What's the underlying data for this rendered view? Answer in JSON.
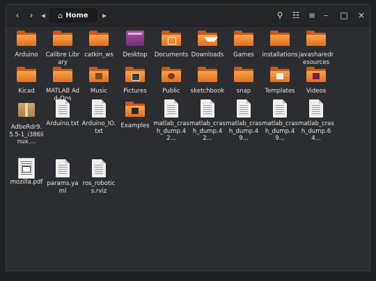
{
  "window": {
    "location": "Home"
  },
  "toolbar": {
    "back_glyph": "‹",
    "forward_glyph": "›",
    "crumb_left_glyph": "◂",
    "crumb_right_glyph": "▸",
    "home_icon": "⌂",
    "search_icon": "⚲",
    "view_icon": "☷",
    "menu_icon": "≡",
    "minimize_glyph": "–",
    "maximize_glyph": "□",
    "close_glyph": "×"
  },
  "items": [
    {
      "label": "Arduino",
      "kind": "folder"
    },
    {
      "label": "Calibre Library",
      "kind": "folder"
    },
    {
      "label": "catkin_ws",
      "kind": "folder"
    },
    {
      "label": "Desktop",
      "kind": "desktop"
    },
    {
      "label": "Documents",
      "kind": "folder-grid"
    },
    {
      "label": "Downloads",
      "kind": "folder-download"
    },
    {
      "label": "Games",
      "kind": "folder"
    },
    {
      "label": "installations",
      "kind": "folder"
    },
    {
      "label": "javasharedresources",
      "kind": "folder"
    },
    {
      "label": "Kicad",
      "kind": "folder"
    },
    {
      "label": "MATLAB Add-Ons",
      "kind": "folder"
    },
    {
      "label": "Music",
      "kind": "folder-music"
    },
    {
      "label": "Pictures",
      "kind": "folder-pictures"
    },
    {
      "label": "Public",
      "kind": "folder-public"
    },
    {
      "label": "sketchbook",
      "kind": "folder"
    },
    {
      "label": "snap",
      "kind": "folder"
    },
    {
      "label": "Templates",
      "kind": "folder-templates"
    },
    {
      "label": "Videos",
      "kind": "folder-videos"
    },
    {
      "label": "AdbeRdr9.5.5-1_i386linux....",
      "kind": "package"
    },
    {
      "label": "Arduino.txt",
      "kind": "document"
    },
    {
      "label": "Arduino_IO.txt",
      "kind": "document"
    },
    {
      "label": "Examples",
      "kind": "folder-link"
    },
    {
      "label": "matlab_crash_dump.42...",
      "kind": "document"
    },
    {
      "label": "matlab_crash_dump.42...",
      "kind": "document"
    },
    {
      "label": "matlab_crash_dump.49...",
      "kind": "document"
    },
    {
      "label": "matlab_crash_dump.49...",
      "kind": "document"
    },
    {
      "label": "matlab_crash_dump.64...",
      "kind": "document"
    },
    {
      "label": "mozilla.pdf",
      "kind": "pdf"
    },
    {
      "label": "params.yaml",
      "kind": "document"
    },
    {
      "label": "ros_robotics.rviz",
      "kind": "document"
    }
  ]
}
